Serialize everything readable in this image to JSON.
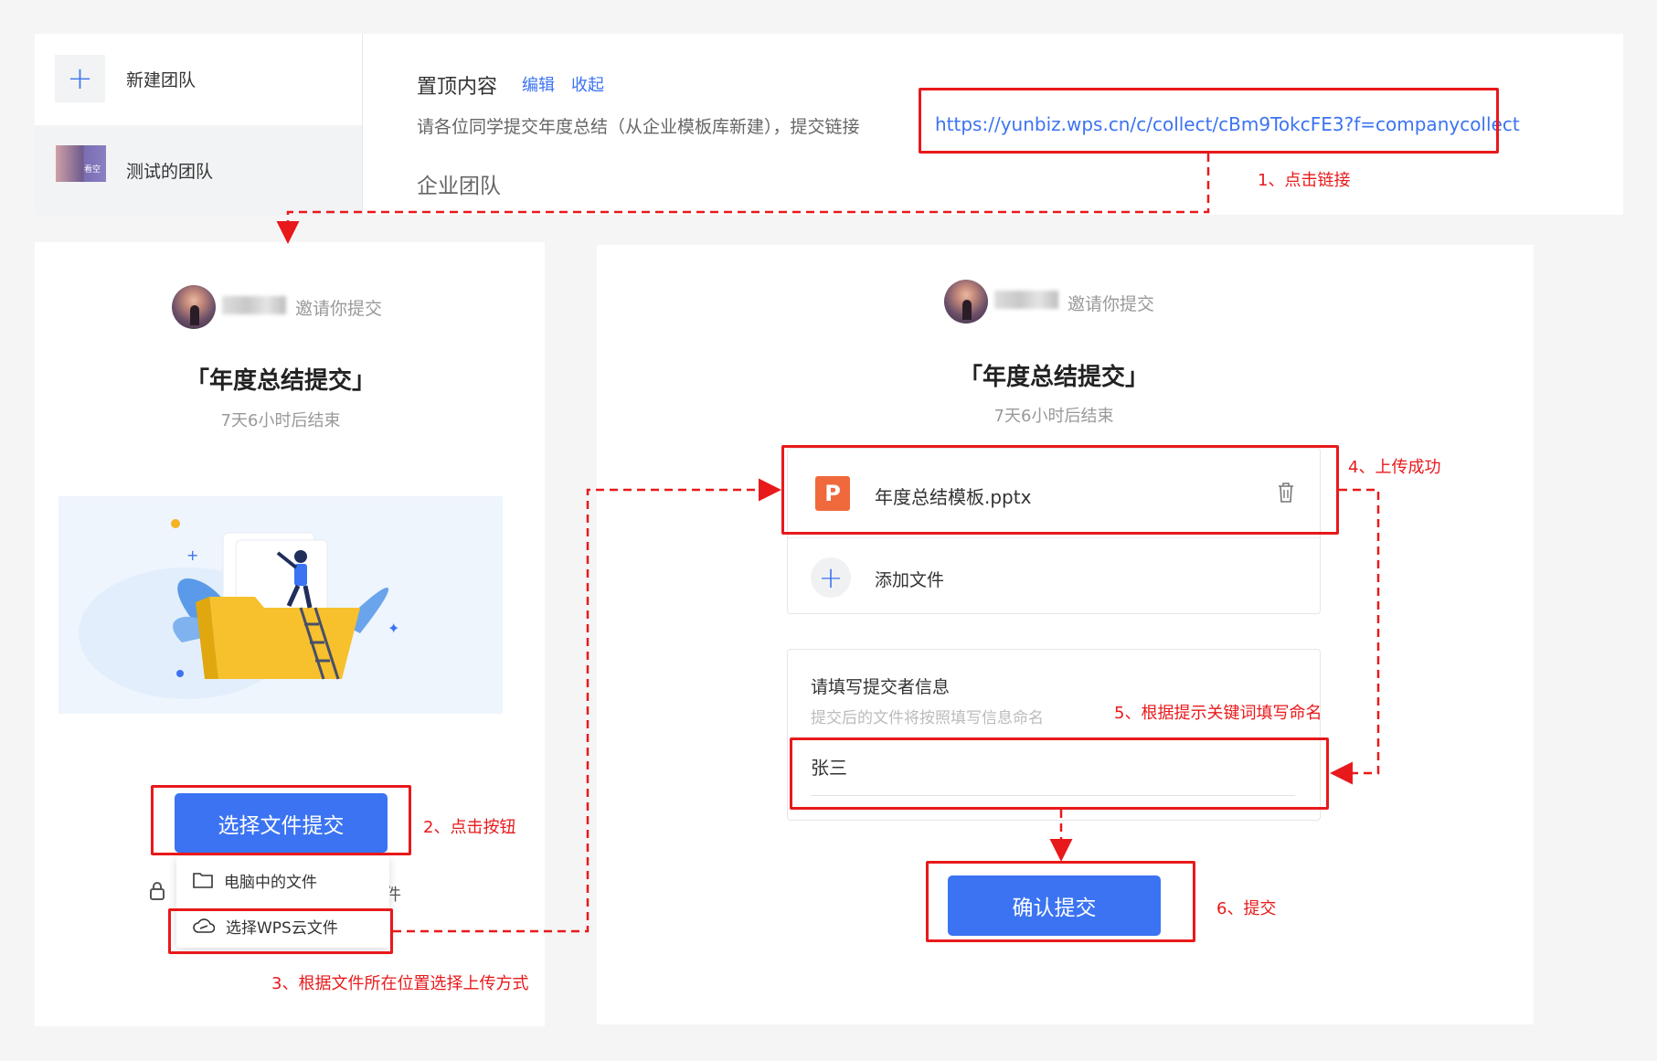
{
  "team_panel": {
    "sidebar": [
      {
        "label": "新建团队",
        "icon": "plus-icon"
      },
      {
        "label": "测试的团队",
        "icon": "team-thumbnail",
        "thumb_label": "看空"
      }
    ],
    "pinned": {
      "title": "置顶内容",
      "edit_label": "编辑",
      "collapse_label": "收起",
      "text": "请各位同学提交年度总结（从企业模板库新建），提交链接",
      "url": "https://yunbiz.wps.cn/c/collect/cBm9TokcFE3?f=companycollect"
    },
    "section_title": "企业团队"
  },
  "left_card": {
    "invite_text": "邀请你提交",
    "title": "「年度总结提交」",
    "subtitle": "7天6小时后结束",
    "select_button": "选择文件提交",
    "menu": [
      {
        "label": "电脑中的文件",
        "icon": "folder-icon"
      },
      {
        "label": "选择WPS云文件",
        "icon": "cloud-icon"
      }
    ],
    "lock_fragment": "件"
  },
  "right_card": {
    "invite_text": "邀请你提交",
    "title": "「年度总结提交」",
    "subtitle": "7天6小时后结束",
    "file_name": "年度总结模板.pptx",
    "add_file": "添加文件",
    "info_title": "请填写提交者信息",
    "info_hint": "提交后的文件将按照填写信息命名",
    "name_value": "张三",
    "confirm_button": "确认提交"
  },
  "steps": {
    "s1": "1、点击链接",
    "s2": "2、点击按钮",
    "s3": "3、根据文件所在位置选择上传方式",
    "s4": "4、上传成功",
    "s5": "5、根据提示关键词填写命名",
    "s6": "6、提交"
  },
  "colors": {
    "accent": "#3b73f2",
    "annotation": "#e8191b",
    "ppt": "#f0693d"
  }
}
